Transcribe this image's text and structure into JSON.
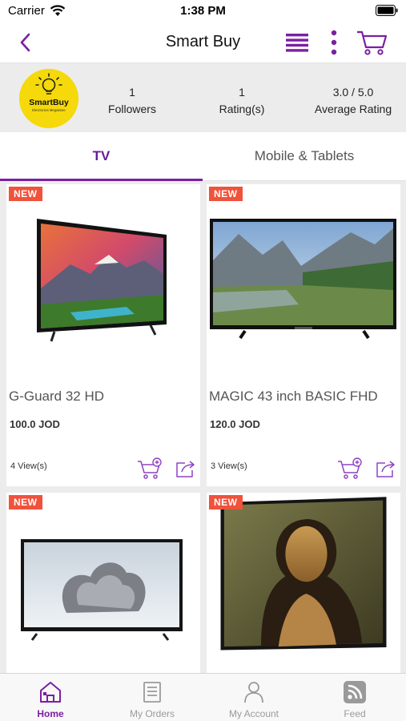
{
  "status_bar": {
    "carrier": "Carrier",
    "time": "1:38 PM"
  },
  "nav": {
    "title": "Smart Buy"
  },
  "store": {
    "logo": {
      "brand": "SmartBuy",
      "tagline": "Electronics Megastore"
    },
    "followers": {
      "value": "1",
      "label": "Followers"
    },
    "ratings": {
      "value": "1",
      "label": "Rating(s)"
    },
    "average": {
      "value": "3.0 / 5.0",
      "label": "Average Rating"
    }
  },
  "tabs": [
    {
      "label": "TV",
      "selected": true
    },
    {
      "label": "Mobile & Tablets",
      "selected": false
    }
  ],
  "products": [
    {
      "badge": "NEW",
      "name": "G-Guard 32 HD",
      "price": "100.0 JOD",
      "views": "4 View(s)"
    },
    {
      "badge": "NEW",
      "name": "MAGIC 43 inch BASIC FHD",
      "price": "120.0 JOD",
      "views": "3 View(s)"
    },
    {
      "badge": "NEW"
    },
    {
      "badge": "NEW"
    }
  ],
  "bottom_tabs": [
    {
      "label": "Home",
      "icon": "home-icon",
      "selected": true
    },
    {
      "label": "My Orders",
      "icon": "orders-icon",
      "selected": false
    },
    {
      "label": "My Account",
      "icon": "account-icon",
      "selected": false
    },
    {
      "label": "Feed",
      "icon": "rss-feed-icon",
      "selected": false
    }
  ],
  "colors": {
    "accent": "#7b1fa2",
    "badge": "#f0523b",
    "logo_yellow": "#f5d90a"
  }
}
